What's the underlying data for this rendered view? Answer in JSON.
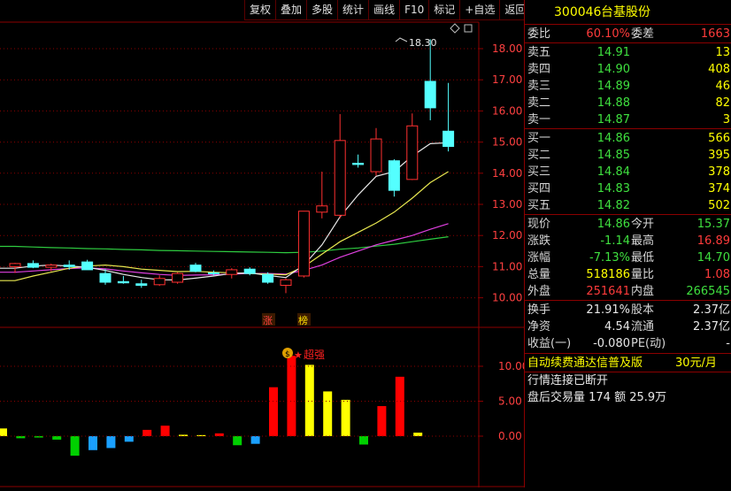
{
  "toolbar": {
    "items": [
      "复权",
      "叠加",
      "多股",
      "统计",
      "画线",
      "F10",
      "标记",
      "+自选",
      "返回"
    ]
  },
  "kline": {
    "price_axis": [
      "18.00",
      "17.00",
      "16.00",
      "15.00",
      "14.00",
      "13.00",
      "12.00",
      "11.00",
      "10.00"
    ],
    "high_label": "18.30",
    "badges": [
      "涨",
      "榜"
    ],
    "candles": [
      {
        "o": 11.0,
        "h": 11.12,
        "l": 10.8,
        "c": 11.1
      },
      {
        "o": 11.1,
        "h": 11.2,
        "l": 10.95,
        "c": 10.98
      },
      {
        "o": 10.98,
        "h": 11.1,
        "l": 10.85,
        "c": 11.05
      },
      {
        "o": 11.05,
        "h": 11.2,
        "l": 10.9,
        "c": 11.0
      },
      {
        "o": 11.15,
        "h": 11.22,
        "l": 10.95,
        "c": 10.9
      },
      {
        "o": 10.78,
        "h": 10.92,
        "l": 10.42,
        "c": 10.5
      },
      {
        "o": 10.52,
        "h": 10.7,
        "l": 10.45,
        "c": 10.48
      },
      {
        "o": 10.45,
        "h": 10.58,
        "l": 10.32,
        "c": 10.4
      },
      {
        "o": 10.42,
        "h": 10.72,
        "l": 10.38,
        "c": 10.62
      },
      {
        "o": 10.5,
        "h": 10.82,
        "l": 10.45,
        "c": 10.78
      },
      {
        "o": 11.05,
        "h": 11.12,
        "l": 10.82,
        "c": 10.85
      },
      {
        "o": 10.8,
        "h": 10.88,
        "l": 10.72,
        "c": 10.78
      },
      {
        "o": 10.75,
        "h": 10.95,
        "l": 10.62,
        "c": 10.9
      },
      {
        "o": 10.92,
        "h": 10.98,
        "l": 10.72,
        "c": 10.78
      },
      {
        "o": 10.75,
        "h": 10.82,
        "l": 10.45,
        "c": 10.5
      },
      {
        "o": 10.4,
        "h": 10.62,
        "l": 10.15,
        "c": 10.58
      },
      {
        "o": 10.7,
        "h": 12.78,
        "l": 10.65,
        "c": 12.78
      },
      {
        "o": 12.75,
        "h": 14.05,
        "l": 12.55,
        "c": 12.95
      },
      {
        "o": 12.65,
        "h": 15.9,
        "l": 12.55,
        "c": 15.05
      },
      {
        "o": 14.32,
        "h": 14.6,
        "l": 14.18,
        "c": 14.28
      },
      {
        "o": 14.05,
        "h": 15.45,
        "l": 13.92,
        "c": 15.1
      },
      {
        "o": 14.4,
        "h": 14.45,
        "l": 13.25,
        "c": 13.45
      },
      {
        "o": 13.8,
        "h": 15.92,
        "l": 13.78,
        "c": 15.52
      },
      {
        "o": 16.95,
        "h": 18.3,
        "l": 15.7,
        "c": 16.1
      },
      {
        "o": 15.35,
        "h": 16.9,
        "l": 14.7,
        "c": 14.86
      }
    ],
    "ma_green": [
      11.65,
      11.63,
      11.61,
      11.6,
      11.58,
      11.57,
      11.55,
      11.54,
      11.52,
      11.51,
      11.5,
      11.49,
      11.48,
      11.47,
      11.46,
      11.45,
      11.46,
      11.5,
      11.56,
      11.6,
      11.66,
      11.72,
      11.8,
      11.88,
      11.96
    ],
    "ma_yellow": [
      10.55,
      10.7,
      10.82,
      10.95,
      11.02,
      11.05,
      11.0,
      10.92,
      10.88,
      10.84,
      10.85,
      10.82,
      10.8,
      10.78,
      10.76,
      10.74,
      11.0,
      11.4,
      11.8,
      12.1,
      12.4,
      12.75,
      13.2,
      13.7,
      14.05
    ],
    "ma_white": [
      10.95,
      11.02,
      11.05,
      11.02,
      10.98,
      10.88,
      10.75,
      10.65,
      10.58,
      10.57,
      10.63,
      10.7,
      10.78,
      10.8,
      10.72,
      10.65,
      11.05,
      11.7,
      12.6,
      13.3,
      13.9,
      14.05,
      14.55,
      14.95,
      14.98
    ],
    "ma_magenta": [
      10.82,
      10.86,
      10.9,
      10.94,
      10.96,
      10.93,
      10.86,
      10.8,
      10.75,
      10.72,
      10.73,
      10.74,
      10.76,
      10.78,
      10.78,
      10.76,
      10.88,
      11.05,
      11.3,
      11.5,
      11.7,
      11.85,
      12.0,
      12.2,
      12.38
    ]
  },
  "indicator": {
    "axis": [
      "10.00",
      "5.00",
      "0.00"
    ],
    "label": "超强",
    "bars": [
      {
        "v": 1.1,
        "c": "#ffff00"
      },
      {
        "v": -0.3,
        "c": "#00d000"
      },
      {
        "v": -0.2,
        "c": "#00d000"
      },
      {
        "v": -0.5,
        "c": "#00d000"
      },
      {
        "v": -2.8,
        "c": "#00d000"
      },
      {
        "v": -2.0,
        "c": "#1aa0ff"
      },
      {
        "v": -1.7,
        "c": "#1aa0ff"
      },
      {
        "v": -0.8,
        "c": "#1aa0ff"
      },
      {
        "v": 0.9,
        "c": "#ff0000"
      },
      {
        "v": 1.5,
        "c": "#ff0000"
      },
      {
        "v": 0.2,
        "c": "#ffff00"
      },
      {
        "v": 0.15,
        "c": "#ffff00"
      },
      {
        "v": 0.4,
        "c": "#ff0000"
      },
      {
        "v": -1.3,
        "c": "#00d000"
      },
      {
        "v": -1.1,
        "c": "#1aa0ff"
      },
      {
        "v": 7.0,
        "c": "#ff0000"
      },
      {
        "v": 11.5,
        "c": "#ff0000"
      },
      {
        "v": 10.2,
        "c": "#ffff00"
      },
      {
        "v": 6.4,
        "c": "#ffff00"
      },
      {
        "v": 5.2,
        "c": "#ffff00"
      },
      {
        "v": -1.2,
        "c": "#00d000"
      },
      {
        "v": 4.3,
        "c": "#ff0000"
      },
      {
        "v": 8.5,
        "c": "#ff0000"
      },
      {
        "v": 0.5,
        "c": "#ffff00"
      }
    ]
  },
  "stock": {
    "code": "300046",
    "name": "台基股份"
  },
  "weibi": {
    "label": "委比",
    "value": "60.10%",
    "label2": "委差",
    "value2": "1663"
  },
  "asks": [
    {
      "label": "卖五",
      "price": "14.91",
      "vol": "13"
    },
    {
      "label": "卖四",
      "price": "14.90",
      "vol": "408"
    },
    {
      "label": "卖三",
      "price": "14.89",
      "vol": "46"
    },
    {
      "label": "卖二",
      "price": "14.88",
      "vol": "82"
    },
    {
      "label": "卖一",
      "price": "14.87",
      "vol": "3"
    }
  ],
  "bids": [
    {
      "label": "买一",
      "price": "14.86",
      "vol": "566"
    },
    {
      "label": "买二",
      "price": "14.85",
      "vol": "395"
    },
    {
      "label": "买三",
      "price": "14.84",
      "vol": "378"
    },
    {
      "label": "买四",
      "price": "14.83",
      "vol": "374"
    },
    {
      "label": "买五",
      "price": "14.82",
      "vol": "502"
    }
  ],
  "quote": [
    {
      "l1": "现价",
      "v1": "14.86",
      "c1": "green",
      "l2": "今开",
      "v2": "15.37",
      "c2": "green"
    },
    {
      "l1": "涨跌",
      "v1": "-1.14",
      "c1": "green",
      "l2": "最高",
      "v2": "16.89",
      "c2": "red"
    },
    {
      "l1": "涨幅",
      "v1": "-7.13%",
      "c1": "green",
      "l2": "最低",
      "v2": "14.70",
      "c2": "green"
    },
    {
      "l1": "总量",
      "v1": "518186",
      "c1": "yellow",
      "l2": "量比",
      "v2": "1.08",
      "c2": "red"
    },
    {
      "l1": "外盘",
      "v1": "251641",
      "c1": "red",
      "l2": "内盘",
      "v2": "266545",
      "c2": "green"
    }
  ],
  "fund": [
    {
      "l1": "换手",
      "v1": "21.91%",
      "l2": "股本",
      "v2": "2.37亿"
    },
    {
      "l1": "净资",
      "v1": "4.54",
      "l2": "流通",
      "v2": "2.37亿"
    },
    {
      "l1": "收益(一)",
      "v1": "-0.080",
      "l2": "PE(动)",
      "v2": "-"
    }
  ],
  "promo": {
    "text": "自动续费通达信普及版",
    "price": "30元/月"
  },
  "status": {
    "text": "行情连接已断开"
  },
  "afterhours": {
    "text": "盘后交易量 174 额 25.9万"
  }
}
